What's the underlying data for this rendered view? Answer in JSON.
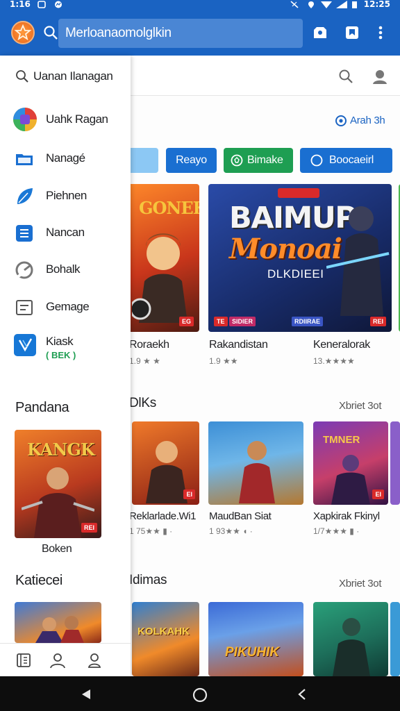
{
  "status_bar": {
    "time": "1:16",
    "right_text": "12:25"
  },
  "app_bar": {
    "search_value": "Merloanaomolglkin"
  },
  "main": {
    "top_link": "Arah 3h",
    "chips": [
      "",
      "Reayo",
      "Bimake",
      "Boocaeirl"
    ],
    "chip_colors": [
      "#8cc8f4",
      "#1a6fd1",
      "#1e9e52",
      "#1a6fd1"
    ],
    "featured": [
      {
        "title": "Roraekh",
        "rating": "1.9 ★ ★",
        "banner": "GONEK"
      },
      {
        "title": "Rakandistan",
        "rating": "1.9 ★★",
        "banner_line1": "BAIMUP",
        "banner_line2": "Monoai",
        "banner_line3": "DLKDIEEI"
      },
      {
        "title": "Keneralorak",
        "rating": "13.★★★★",
        "banner": ""
      }
    ],
    "section2": {
      "title": "DlKs",
      "see_more": "Xbriet 3ot",
      "cards": [
        {
          "title": "Reklarlade.Wi1",
          "rating": "1 75★★ ▮ ·"
        },
        {
          "title": "MaudBan Siat",
          "rating": "1 93★★ ◖ ·"
        },
        {
          "title": "Xapkirak Fkinyl",
          "rating": "1/7★★★ ▮ ·"
        }
      ]
    },
    "section3": {
      "title": "Idimas",
      "see_more": "Xbriet 3ot",
      "banners": [
        "KOLKAHK",
        "PIKUHIK"
      ]
    }
  },
  "drawer": {
    "search_label": "Uanan Ilanagan",
    "items": [
      {
        "label": "Uahk Ragan",
        "icon": "avatar-icon"
      },
      {
        "label": "Nanagé",
        "icon": "folder-icon"
      },
      {
        "label": "Piehnen",
        "icon": "leaf-icon"
      },
      {
        "label": "Nancan",
        "icon": "document-icon"
      },
      {
        "label": "Bohalk",
        "icon": "refresh-icon"
      },
      {
        "label": "Gemage",
        "icon": "list-icon"
      },
      {
        "label": "Kiask",
        "icon": "app-logo-icon",
        "sub": "( BEK )"
      }
    ],
    "section1_title": "Pandana",
    "card": {
      "title": "Boken",
      "banner": "KANGK"
    },
    "section2_title": "Katiecei"
  }
}
